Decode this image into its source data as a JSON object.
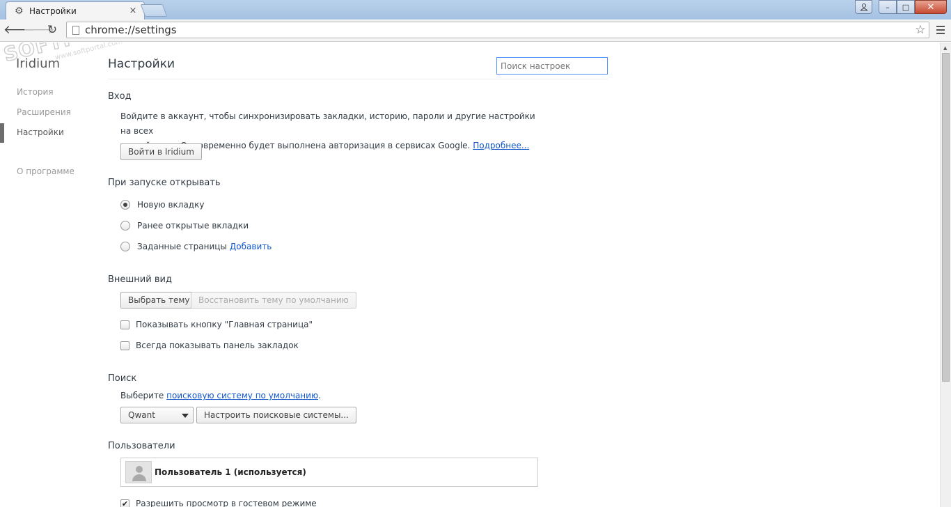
{
  "window": {
    "tab_title": "Настройки",
    "tab_close": "×",
    "controls": {
      "minimize": "–",
      "maximize": "□",
      "close": "✕"
    }
  },
  "toolbar": {
    "url": "chrome://settings"
  },
  "watermark": {
    "main": "SOFTPORTAL",
    "sub": "www.softportal.com"
  },
  "sidebar": {
    "brand": "Iridium",
    "items": [
      {
        "label": "История",
        "active": false
      },
      {
        "label": "Расширения",
        "active": false
      },
      {
        "label": "Настройки",
        "active": true
      },
      {
        "label": "О программе",
        "active": false
      }
    ]
  },
  "main": {
    "title": "Настройки",
    "search_placeholder": "Поиск настроек",
    "signin": {
      "heading": "Вход",
      "text_line1": "Войдите в аккаунт, чтобы синхронизировать закладки, историю, пароли и другие настройки на всех",
      "text_line2": "устройствах. Одновременно будет выполнена авторизация в сервисах Google.",
      "learn_more": "Подробнее...",
      "button": "Войти в Iridium"
    },
    "startup": {
      "heading": "При запуске открывать",
      "options": [
        {
          "label": "Новую вкладку",
          "checked": true
        },
        {
          "label": "Ранее открытые вкладки",
          "checked": false
        },
        {
          "label": "Заданные страницы",
          "checked": false
        }
      ],
      "add_link": "Добавить"
    },
    "appearance": {
      "heading": "Внешний вид",
      "choose_theme": "Выбрать тему",
      "reset_theme": "Восстановить тему по умолчанию",
      "checkboxes": [
        {
          "label": "Показывать кнопку \"Главная страница\"",
          "checked": false
        },
        {
          "label": "Всегда показывать панель закладок",
          "checked": false
        }
      ]
    },
    "search": {
      "heading": "Поиск",
      "prefix": "Выберите ",
      "link": "поисковую систему по умолчанию",
      "suffix": ".",
      "engine": "Qwant",
      "manage_button": "Настроить поисковые системы..."
    },
    "users": {
      "heading": "Пользователи",
      "current_user": "Пользователь 1 (используется)",
      "guest_mode": {
        "label": "Разрешить просмотр в гостевом режиме",
        "checked": true
      }
    }
  }
}
